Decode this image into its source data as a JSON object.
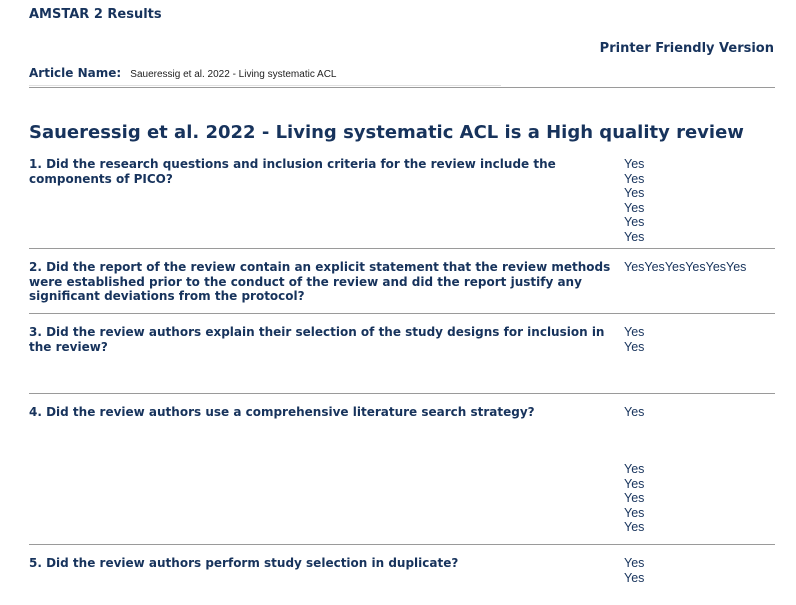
{
  "header": {
    "title": "AMSTAR 2 Results",
    "printer_link": "Printer Friendly Version"
  },
  "article": {
    "label": "Article Name:",
    "value": "Saueressig et al. 2022 - Living systematic ACL"
  },
  "review_heading": "Saueressig et al. 2022 - Living systematic ACL is a High quality review",
  "questions": [
    {
      "text": "1. Did the research questions and inclusion criteria for the review include the components of PICO?",
      "answers": [
        "Yes",
        "Yes",
        "Yes",
        "Yes",
        "Yes",
        "Yes"
      ]
    },
    {
      "text": "2. Did the report of the review contain an explicit statement that the review methods were established prior to the conduct of the review and did the report justify any significant deviations from the protocol?",
      "answers": [
        "Yes",
        "Yes",
        "Yes",
        "Yes",
        "Yes",
        "Yes"
      ]
    },
    {
      "text": "3. Did the review authors explain their selection of the study designs for inclusion in the review?",
      "answers": [
        "Yes",
        "Yes"
      ]
    },
    {
      "text": "4. Did the review authors use a comprehensive literature search strategy?",
      "answers": [
        "Yes"
      ],
      "answers_lower": [
        "Yes",
        "Yes",
        "Yes",
        "Yes",
        "Yes"
      ]
    },
    {
      "text": "5. Did the review authors perform study selection in duplicate?",
      "answers": [
        "Yes",
        "Yes"
      ]
    }
  ]
}
